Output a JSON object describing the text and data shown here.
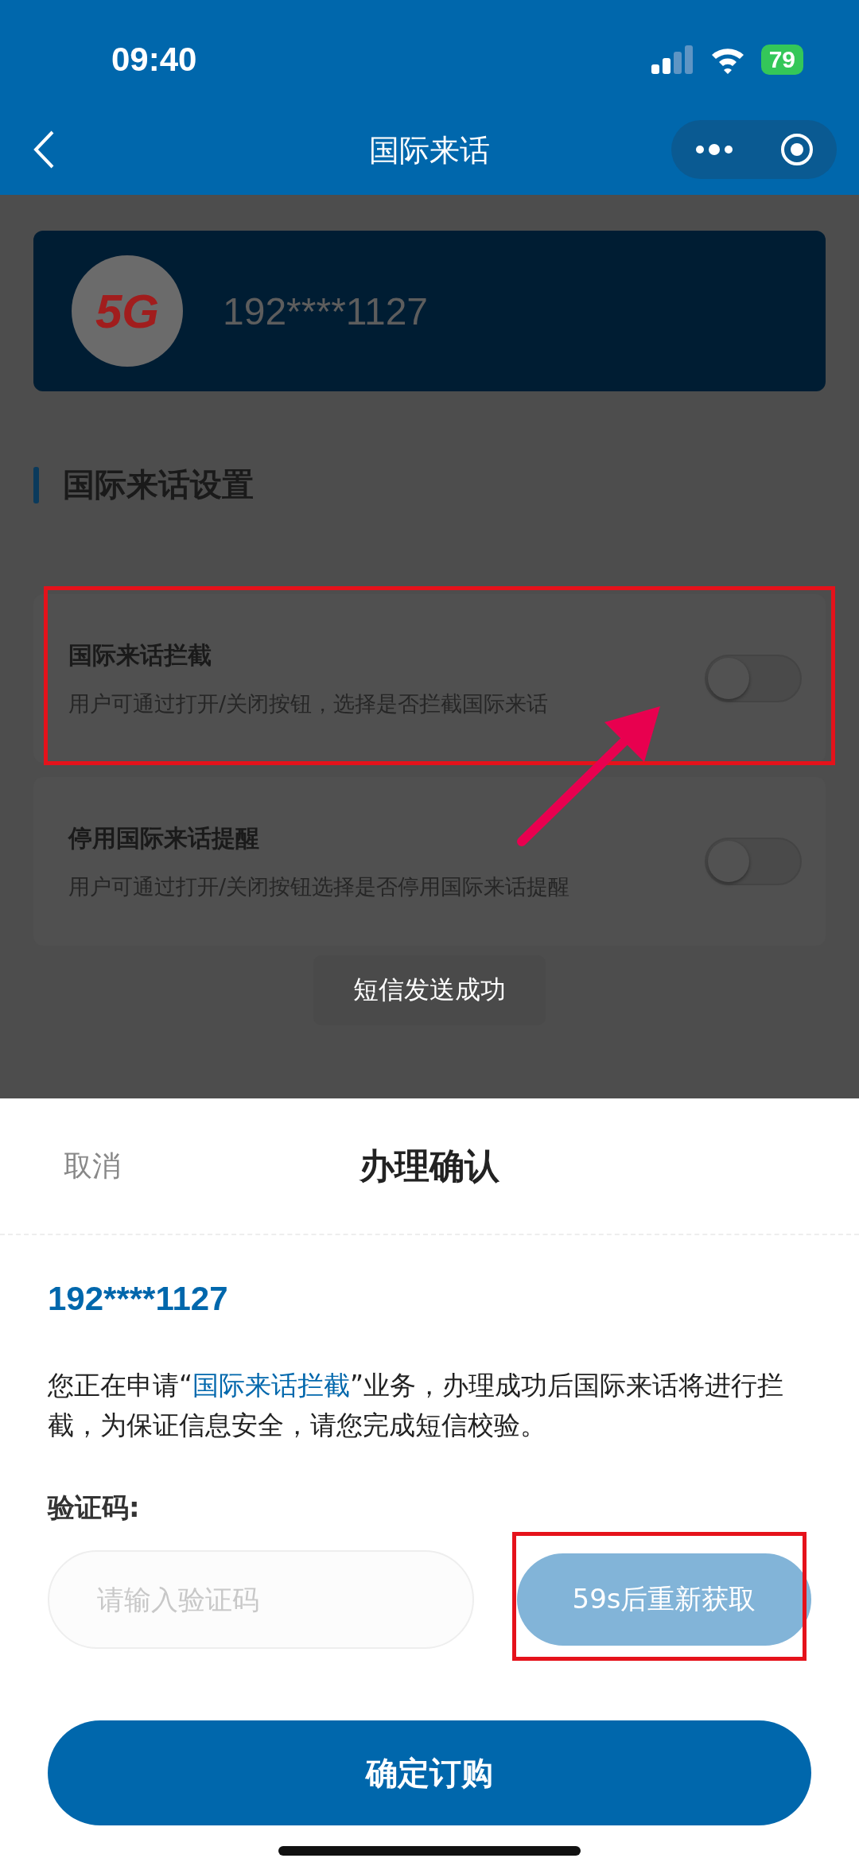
{
  "status_bar": {
    "time": "09:40",
    "battery": "79"
  },
  "nav": {
    "title": "国际来话"
  },
  "account_card": {
    "logo_text": "5G",
    "phone": "192****1127"
  },
  "section": {
    "title": "国际来话设置"
  },
  "settings": [
    {
      "title": "国际来话拦截",
      "description": "用户可通过打开/关闭按钮，选择是否拦截国际来话",
      "on": false
    },
    {
      "title": "停用国际来话提醒",
      "description": "用户可通过打开/关闭按钮选择是否停用国际来话提醒",
      "on": false
    }
  ],
  "toast": "短信发送成功",
  "sheet": {
    "cancel": "取消",
    "title": "办理确认",
    "phone": "192****1127",
    "notice_before": "您正在申请“",
    "notice_link": "国际来话拦截",
    "notice_after": "”业务，办理成功后国际来话将进行拦截，为保证信息安全，请您完成短信校验。",
    "code_label": "验证码:",
    "code_placeholder": "请输入验证码",
    "resend_button": "59s后重新获取",
    "confirm_button": "确定订购"
  }
}
